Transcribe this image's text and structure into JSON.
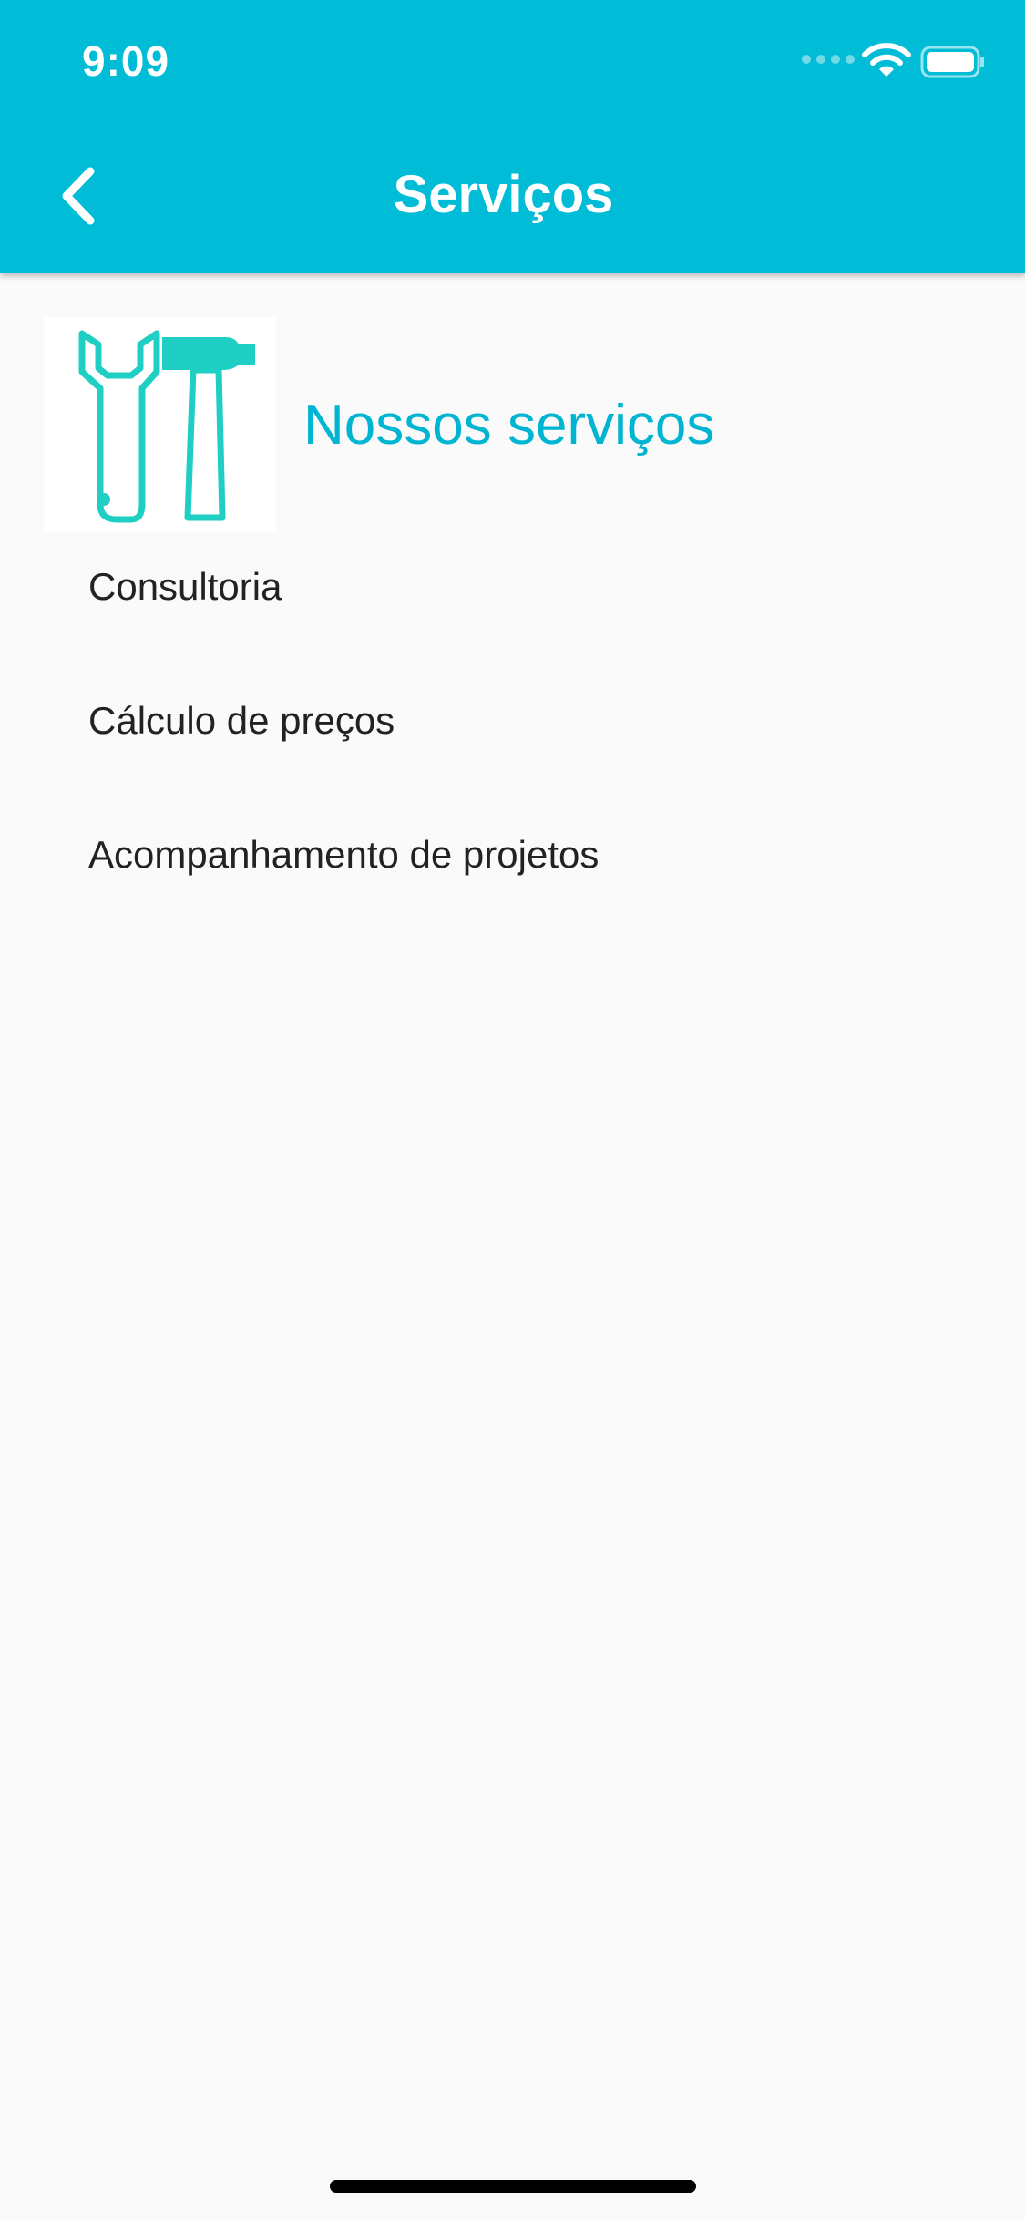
{
  "status_bar": {
    "time": "9:09"
  },
  "nav": {
    "title": "Serviços",
    "back_icon": "chevron-left-icon"
  },
  "header": {
    "image_icon": "wrench-hammer-icon",
    "title": "Nossos serviços"
  },
  "services": [
    {
      "label": "Consultoria"
    },
    {
      "label": "Cálculo de preços"
    },
    {
      "label": "Acompanhamento de projetos"
    }
  ],
  "colors": {
    "primary": "#00bcd6",
    "section_title": "#00b5d1",
    "icon_accent": "#1fcfc4",
    "background": "#fafafa"
  }
}
